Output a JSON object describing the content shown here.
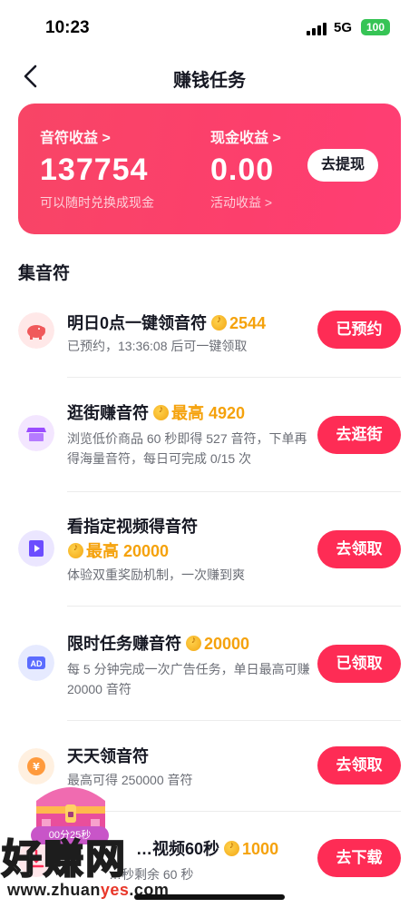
{
  "status_bar": {
    "time": "10:23",
    "network": "5G",
    "battery": "100"
  },
  "nav": {
    "title": "赚钱任务"
  },
  "earnings": {
    "notes": {
      "label": "音符收益 >",
      "value": "137754",
      "sub": "可以随时兑换成现金"
    },
    "cash": {
      "label": "现金收益 >",
      "value": "0.00",
      "sub": "活动收益 >"
    },
    "withdraw_label": "去提现"
  },
  "section_title": "集音符",
  "tasks": [
    {
      "icon": "piggy-bank-icon",
      "title": "明日0点一键领音符",
      "reward_prefix": "",
      "reward": "2544",
      "desc": "已预约，13:36:08  后可一键领取",
      "button": "已预约"
    },
    {
      "icon": "store-icon",
      "title": "逛街赚音符",
      "reward_prefix": "最高",
      "reward": "4920",
      "desc": "浏览低价商品 60 秒即得 527 音符，下单再得海量音符，每日可完成 0/15 次",
      "button": "去逛街"
    },
    {
      "icon": "video-icon",
      "title": "看指定视频得音符",
      "reward_prefix": "最高",
      "reward": "20000",
      "desc": "体验双重奖励机制，一次赚到爽",
      "button": "去领取"
    },
    {
      "icon": "ad-icon",
      "title": "限时任务赚音符",
      "reward_prefix": "",
      "reward": "20000",
      "desc": "每 5 分钟完成一次广告任务，单日最高可赚 20000 音符",
      "button": "已领取"
    },
    {
      "icon": "yen-coin-icon",
      "title": "天天领音符",
      "reward_prefix": "",
      "reward": "",
      "desc": "最高可得 250000 音符",
      "button": "去领取"
    },
    {
      "icon": "download-icon",
      "title": "…视频60秒",
      "reward_prefix": "",
      "reward": "1000",
      "desc": "…秒剩余 60 秒",
      "button": "去下载"
    }
  ],
  "chest_timer": "00分25秒",
  "watermark": {
    "text": "好赚网",
    "url_prefix": "www.zhuan",
    "url_accent": "yes",
    "url_suffix": ".com"
  },
  "colors": {
    "accent": "#fe2c55",
    "card_gradient_start": "#f84566",
    "card_gradient_end": "#ff3e74",
    "reward": "#f5a20c"
  }
}
